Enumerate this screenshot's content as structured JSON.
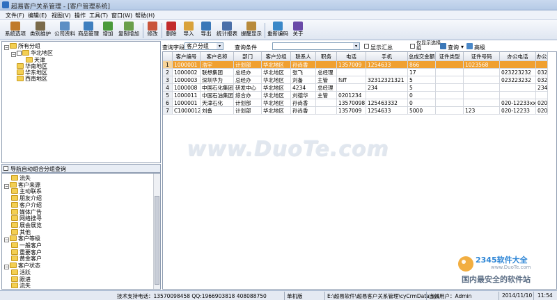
{
  "window": {
    "title": "超易客户关系管理 - [客户管理系统]"
  },
  "menu": [
    "文件(F)",
    "编辑(E)",
    "视图(V)",
    "操作",
    "工具(T)",
    "窗口(W)",
    "帮助(H)"
  ],
  "toolbar": [
    {
      "label": "系统选项",
      "icon": "settings-icon",
      "color": "#c07a2a"
    },
    {
      "label": "类别维护",
      "icon": "tools-icon",
      "color": "#7a6a4a"
    },
    {
      "label": "公司资料",
      "icon": "profile-icon",
      "color": "#5d8fc4"
    },
    {
      "label": "商品管理",
      "icon": "box-icon",
      "color": "#3f7fbf"
    },
    {
      "label": "增加",
      "icon": "add-icon",
      "color": "#4a9a3a"
    },
    {
      "label": "复制增加",
      "icon": "copy-add-icon",
      "color": "#6a9f4a"
    },
    {
      "label": "修改",
      "icon": "edit-icon",
      "color": "#c9543a"
    },
    {
      "label": "删除",
      "icon": "delete-icon",
      "color": "#c22b2b"
    },
    {
      "label": "导入",
      "icon": "import-icon",
      "color": "#d9a23a"
    },
    {
      "label": "导出",
      "icon": "export-icon",
      "color": "#3a78b8"
    },
    {
      "label": "统计报表",
      "icon": "report-icon",
      "color": "#4a6fa8"
    },
    {
      "label": "提醒显示",
      "icon": "reminder-icon",
      "color": "#b88a3a"
    },
    {
      "label": "重新编码",
      "icon": "recode-icon",
      "color": "#3a88c8"
    },
    {
      "label": "关于",
      "icon": "help-icon",
      "color": "#6a4aa8"
    }
  ],
  "left_tree": {
    "root": "所有分组",
    "group": "华北地区",
    "group_child": "天津",
    "others": [
      "华南地区",
      "华东地区",
      "西南地区"
    ]
  },
  "nav_panel": {
    "title": "导航自动组合分组查询",
    "items": [
      {
        "label": "流失",
        "level": 1
      },
      {
        "label": "客户来源",
        "level": 0
      },
      {
        "label": "主动联系",
        "level": 1
      },
      {
        "label": "朋友介绍",
        "level": 1
      },
      {
        "label": "客户介绍",
        "level": 1
      },
      {
        "label": "媒体广告",
        "level": 1
      },
      {
        "label": "网络搜寻",
        "level": 1
      },
      {
        "label": "展会展览",
        "level": 1
      },
      {
        "label": "其他",
        "level": 1
      },
      {
        "label": "客户等级",
        "level": 0
      },
      {
        "label": "一般客户",
        "level": 1
      },
      {
        "label": "重要客户",
        "level": 1
      },
      {
        "label": "黄金客户",
        "level": 1
      },
      {
        "label": "客户状态",
        "level": 0
      },
      {
        "label": "活跃",
        "level": 1
      },
      {
        "label": "跟进",
        "level": 1
      },
      {
        "label": "流失",
        "level": 1
      }
    ]
  },
  "query": {
    "field_label": "查询字段",
    "field_value": "客户分组",
    "cond_label": "查询条件",
    "cond_value": "",
    "summary_label": "显示汇总",
    "only_label": "仅显示选择组",
    "search_label": "查询",
    "advanced_label": "高级"
  },
  "table": {
    "columns": [
      "客户编号",
      "客户名称",
      "部门",
      "客户分组",
      "联系人",
      "职务",
      "电话",
      "手机",
      "总成交金额",
      "证件类型",
      "证件号码",
      "办公电话",
      "办公"
    ],
    "rows": [
      [
        "1000001",
        "浩宇",
        "计划部",
        "华北地区",
        "孙尚香",
        "",
        "1357009",
        "1254633",
        "866",
        "",
        "1023568",
        "",
        ""
      ],
      [
        "1000002",
        "联想集团",
        "总经办",
        "华北地区",
        "张飞",
        "总经理",
        "",
        "",
        "17",
        "",
        "",
        "023223232",
        "0323"
      ],
      [
        "1000003",
        "深圳华为",
        "总经办",
        "华北地区",
        "刘备",
        "主管",
        "fsff",
        "32312321321",
        "5",
        "",
        "",
        "023223232",
        "0323"
      ],
      [
        "1000008",
        "中国石化集团",
        "研发中心",
        "华北地区",
        "4234",
        "总经理",
        "",
        "234",
        "5",
        "",
        "",
        "",
        "234"
      ],
      [
        "1000011",
        "中国石油集团勘探",
        "综合办",
        "华北地区",
        "刘德华",
        "主管",
        "0201234",
        "",
        "0",
        "",
        "",
        "",
        ""
      ],
      [
        "1000001",
        "天津石化",
        "计划部",
        "华北地区",
        "孙尚香",
        "",
        "13570098",
        "125463332",
        "0",
        "",
        "",
        "020-12233xx",
        "020"
      ],
      [
        "C1000012",
        "刘备",
        "计划部",
        "华北地区",
        "孙尚香",
        "",
        "1357009",
        "1254633",
        "5000",
        "",
        "123",
        "020-12233",
        "020"
      ]
    ],
    "row_numbers": [
      "1",
      "2",
      "3",
      "4",
      "5",
      "6",
      "7"
    ],
    "selected_row": 0,
    "selected_color": "#f0a030"
  },
  "status": {
    "support": "技术支持电话：13570098458 QQ:1966903818 408088750",
    "mode": "单机版",
    "path": "E:\\超易软件\\超易客户关系管理\\cyCrmData.sys",
    "user": "当前用户：Admin",
    "date": "2014/11/10",
    "time": "11:54"
  },
  "watermark": {
    "text": "www.DuoTe.com",
    "logo_brand": "2345软件大全",
    "logo_url": "www.DuoTe.com",
    "logo_slogan": "国内最安全的软件站"
  }
}
